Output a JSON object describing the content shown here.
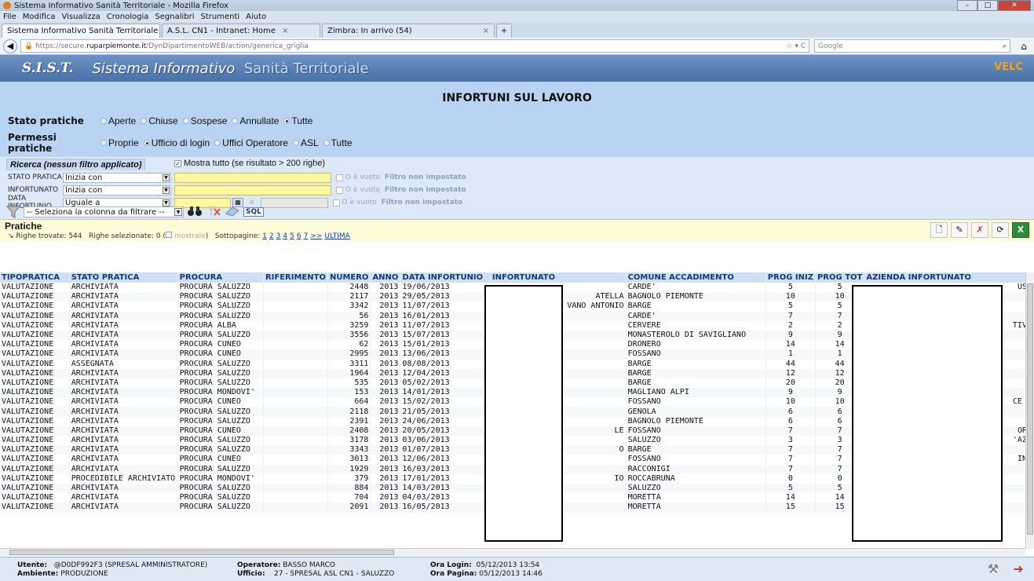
{
  "browser": {
    "window_title": "Sistema Informativo Sanità Territoriale - Mozilla Firefox",
    "menu": [
      "File",
      "Modifica",
      "Visualizza",
      "Cronologia",
      "Segnalibri",
      "Strumenti",
      "Aiuto"
    ],
    "tabs": [
      {
        "label": "Sistema Informativo Sanità Territoriale"
      },
      {
        "label": "A.S.L. CN1 - Intranet: Home"
      },
      {
        "label": "Zimbra: In arrivo (54)"
      }
    ],
    "url_prefix": "https://secure.",
    "url_domain": "ruparpiemonte.it",
    "url_rest": "/DynDipartimentoWEB/action/generica_griglia",
    "search_placeholder": "Google"
  },
  "app": {
    "logo": "S.I.S.T.",
    "title_part1": "Sistema Informativo",
    "title_part2": "Sanità Territoriale",
    "brand": "VELC"
  },
  "page": {
    "title": "INFORTUNI SUL LAVORO",
    "stato_label": "Stato pratiche",
    "stato_options": [
      {
        "label": "Aperte",
        "selected": false
      },
      {
        "label": "Chiuse",
        "selected": false
      },
      {
        "label": "Sospese",
        "selected": false
      },
      {
        "label": "Annullate",
        "selected": false
      },
      {
        "label": "Tutte",
        "selected": true
      }
    ],
    "permessi_label": "Permessi pratiche",
    "permessi_options": [
      {
        "label": "Proprie",
        "selected": false
      },
      {
        "label": "Ufficio di login",
        "selected": true
      },
      {
        "label": "Uffici Operatore",
        "selected": false
      },
      {
        "label": "ASL",
        "selected": false
      },
      {
        "label": "Tutte",
        "selected": false
      }
    ]
  },
  "search": {
    "header": "Ricerca (nessun filtro applicato)",
    "mostra_tutto": "Mostra tutto (se risultato > 200 righe)",
    "mostra_checked": true,
    "filters": [
      {
        "label": "STATO PRATICA",
        "op": "Inizia con",
        "vuoto": "O è vuoto",
        "status": "Filtro non impostato"
      },
      {
        "label": "INFORTUNATO",
        "op": "Inizia con",
        "vuoto": "O è vuoto",
        "status": "Filtro non impostato"
      },
      {
        "label": "DATA INFORTUNIO",
        "op": "Uguale a",
        "vuoto": "O è vuoto",
        "status": "Filtro non impostato",
        "between": "e"
      }
    ],
    "column_select": "-- Seleziona la colonna da filtrare --",
    "sql_label": "SQL"
  },
  "results": {
    "title": "Pratiche",
    "righe_trovate": "Righe trovate: 544",
    "righe_selezionate": "Righe selezionate: 0",
    "mostrale": "mostrale",
    "sottopagine_label": "Sottopagine:",
    "pages": [
      "1",
      "2",
      "3",
      "4",
      "5",
      "6",
      "7",
      ">>",
      "ULTIMA"
    ],
    "columns": [
      "TIPOPRATICA",
      "STATO PRATICA",
      "PROCURA",
      "RIFERIMENTO",
      "NUMERO",
      "ANNO",
      "DATA INFORTUNIO",
      "INFORTUNATO",
      "COMUNE ACCADIMENTO",
      "PROG INIZ",
      "PROG TOT",
      "AZIENDA INFORTUNATO"
    ],
    "rows": [
      [
        "VALUTAZIONE",
        "ARCHIVIATA",
        "PROCURA SALUZZO",
        "",
        "2448",
        "2013",
        "19/06/2013",
        "",
        "CARDE'",
        "5",
        "5",
        "USE"
      ],
      [
        "VALUTAZIONE",
        "ARCHIVIATA",
        "PROCURA SALUZZO",
        "",
        "2117",
        "2013",
        "29/05/2013",
        "ATELLA",
        "BAGNOLO PIEMONTE",
        "10",
        "10",
        ""
      ],
      [
        "VALUTAZIONE",
        "ARCHIVIATA",
        "PROCURA SALUZZO",
        "",
        "3342",
        "2013",
        "11/07/2013",
        "VANO ANTONIO",
        "BARGE",
        "5",
        "5",
        ""
      ],
      [
        "VALUTAZIONE",
        "ARCHIVIATA",
        "PROCURA SALUZZO",
        "",
        "56",
        "2013",
        "16/01/2013",
        "",
        "CARDE'",
        "7",
        "7",
        ""
      ],
      [
        "VALUTAZIONE",
        "ARCHIVIATA",
        "PROCURA ALBA",
        "",
        "3259",
        "2013",
        "11/07/2013",
        "",
        "CERVERE",
        "2",
        "2",
        "TIVA"
      ],
      [
        "VALUTAZIONE",
        "ARCHIVIATA",
        "PROCURA SALUZZO",
        "",
        "3556",
        "2013",
        "15/07/2013",
        "",
        "MONASTEROLO DI SAVIGLIANO",
        "9",
        "9",
        ""
      ],
      [
        "VALUTAZIONE",
        "ARCHIVIATA",
        "PROCURA CUNEO",
        "",
        "62",
        "2013",
        "15/01/2013",
        "",
        "DRONERO",
        "14",
        "14",
        ""
      ],
      [
        "VALUTAZIONE",
        "ARCHIVIATA",
        "PROCURA CUNEO",
        "",
        "2995",
        "2013",
        "13/06/2013",
        "",
        "FOSSANO",
        "1",
        "1",
        ""
      ],
      [
        "VALUTAZIONE",
        "ASSEGNATA",
        "PROCURA SALUZZO",
        "",
        "3311",
        "2013",
        "08/08/2013",
        "",
        "BARGE",
        "44",
        "44",
        ""
      ],
      [
        "VALUTAZIONE",
        "ARCHIVIATA",
        "PROCURA SALUZZO",
        "",
        "1964",
        "2013",
        "12/04/2013",
        "",
        "BARGE",
        "12",
        "12",
        ""
      ],
      [
        "VALUTAZIONE",
        "ARCHIVIATA",
        "PROCURA SALUZZO",
        "",
        "535",
        "2013",
        "05/02/2013",
        "",
        "BARGE",
        "20",
        "20",
        ""
      ],
      [
        "VALUTAZIONE",
        "ARCHIVIATA",
        "PROCURA MONDOVI'",
        "",
        "153",
        "2013",
        "14/01/2013",
        "",
        "MAGLIANO ALPI",
        "9",
        "9",
        ""
      ],
      [
        "VALUTAZIONE",
        "ARCHIVIATA",
        "PROCURA CUNEO",
        "",
        "664",
        "2013",
        "15/02/2013",
        "",
        "FOSSANO",
        "10",
        "10",
        "CE I"
      ],
      [
        "VALUTAZIONE",
        "ARCHIVIATA",
        "PROCURA SALUZZO",
        "",
        "2118",
        "2013",
        "21/05/2013",
        "",
        "GENOLA",
        "6",
        "6",
        ""
      ],
      [
        "VALUTAZIONE",
        "ARCHIVIATA",
        "PROCURA SALUZZO",
        "",
        "2391",
        "2013",
        "24/06/2013",
        "",
        "BAGNOLO PIEMONTE",
        "6",
        "6",
        ""
      ],
      [
        "VALUTAZIONE",
        "ARCHIVIATA",
        "PROCURA CUNEO",
        "",
        "2408",
        "2013",
        "20/05/2013",
        "LE",
        "FOSSANO",
        "7",
        "7",
        "ORN"
      ],
      [
        "VALUTAZIONE",
        "ARCHIVIATA",
        "PROCURA SALUZZO",
        "",
        "3178",
        "2013",
        "03/06/2013",
        "",
        "SALUZZO",
        "3",
        "3",
        "'AZE"
      ],
      [
        "VALUTAZIONE",
        "ARCHIVIATA",
        "PROCURA SALUZZO",
        "",
        "3343",
        "2013",
        "01/07/2013",
        "O",
        "BARGE",
        "7",
        "7",
        ""
      ],
      [
        "VALUTAZIONE",
        "ARCHIVIATA",
        "PROCURA CUNEO",
        "",
        "3013",
        "2013",
        "12/06/2013",
        "",
        "FOSSANO",
        "7",
        "7",
        "INA"
      ],
      [
        "VALUTAZIONE",
        "ARCHIVIATA",
        "PROCURA SALUZZO",
        "",
        "1929",
        "2013",
        "16/03/2013",
        "",
        "RACCONIGI",
        "7",
        "7",
        ""
      ],
      [
        "VALUTAZIONE",
        "PROCEDIBILE ARCHIVIATO",
        "PROCURA MONDOVI'",
        "",
        "379",
        "2013",
        "17/01/2013",
        "IO",
        "ROCCABRUNA",
        "0",
        "0",
        ""
      ],
      [
        "VALUTAZIONE",
        "ARCHIVIATA",
        "PROCURA SALUZZO",
        "",
        "884",
        "2013",
        "14/03/2013",
        "",
        "SALUZZO",
        "5",
        "5",
        ""
      ],
      [
        "VALUTAZIONE",
        "ARCHIVIATA",
        "PROCURA SALUZZO",
        "",
        "704",
        "2013",
        "04/03/2013",
        "",
        "MORETTA",
        "14",
        "14",
        ""
      ],
      [
        "VALUTAZIONE",
        "ARCHIVIATA",
        "PROCURA SALUZZO",
        "",
        "2091",
        "2013",
        "16/05/2013",
        "",
        "MORETTA",
        "15",
        "15",
        ""
      ]
    ]
  },
  "status": {
    "utente_label": "Utente:",
    "utente_value": "@D0DF992F3 (SPRESAL AMMINISTRATORE)",
    "ambiente_label": "Ambiente:",
    "ambiente_value": "PRODUZIONE",
    "operatore_label": "Operatore:",
    "operatore_value": "BASSO MARCO",
    "ufficio_label": "Ufficio:",
    "ufficio_value": "27 - SPRESAL ASL CN1 - SALUZZO",
    "ora_login_label": "Ora Login:",
    "ora_login_value": "05/12/2013 13:54",
    "ora_pagina_label": "Ora Pagina:",
    "ora_pagina_value": "05/12/2013 14:46"
  }
}
